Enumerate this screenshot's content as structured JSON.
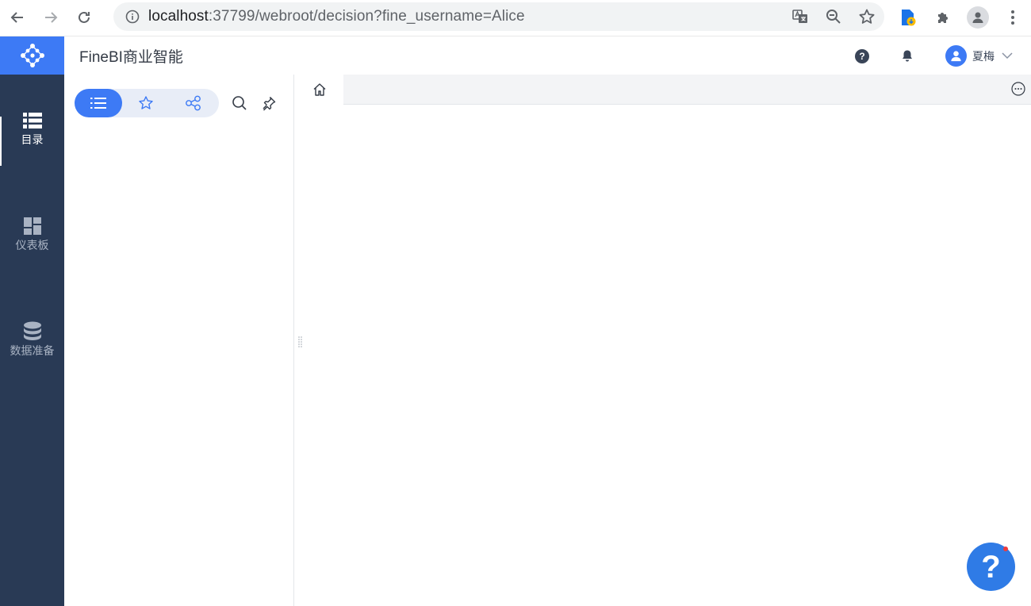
{
  "browser": {
    "url_host": "localhost",
    "url_rest": ":37799/webroot/decision?fine_username=Alice"
  },
  "app": {
    "title": "FineBI商业智能",
    "username": "夏梅"
  },
  "left_nav": {
    "items": [
      {
        "label": "目录",
        "icon": "list-icon",
        "active": true
      },
      {
        "label": "仪表板",
        "icon": "dashboard-icon",
        "active": false
      },
      {
        "label": "数据准备",
        "icon": "database-icon",
        "active": false
      }
    ]
  },
  "float_help": {
    "label": "?"
  },
  "colors": {
    "accent": "#3d7af5",
    "nav_bg": "#293a55",
    "header_bg": "#ffffff"
  }
}
